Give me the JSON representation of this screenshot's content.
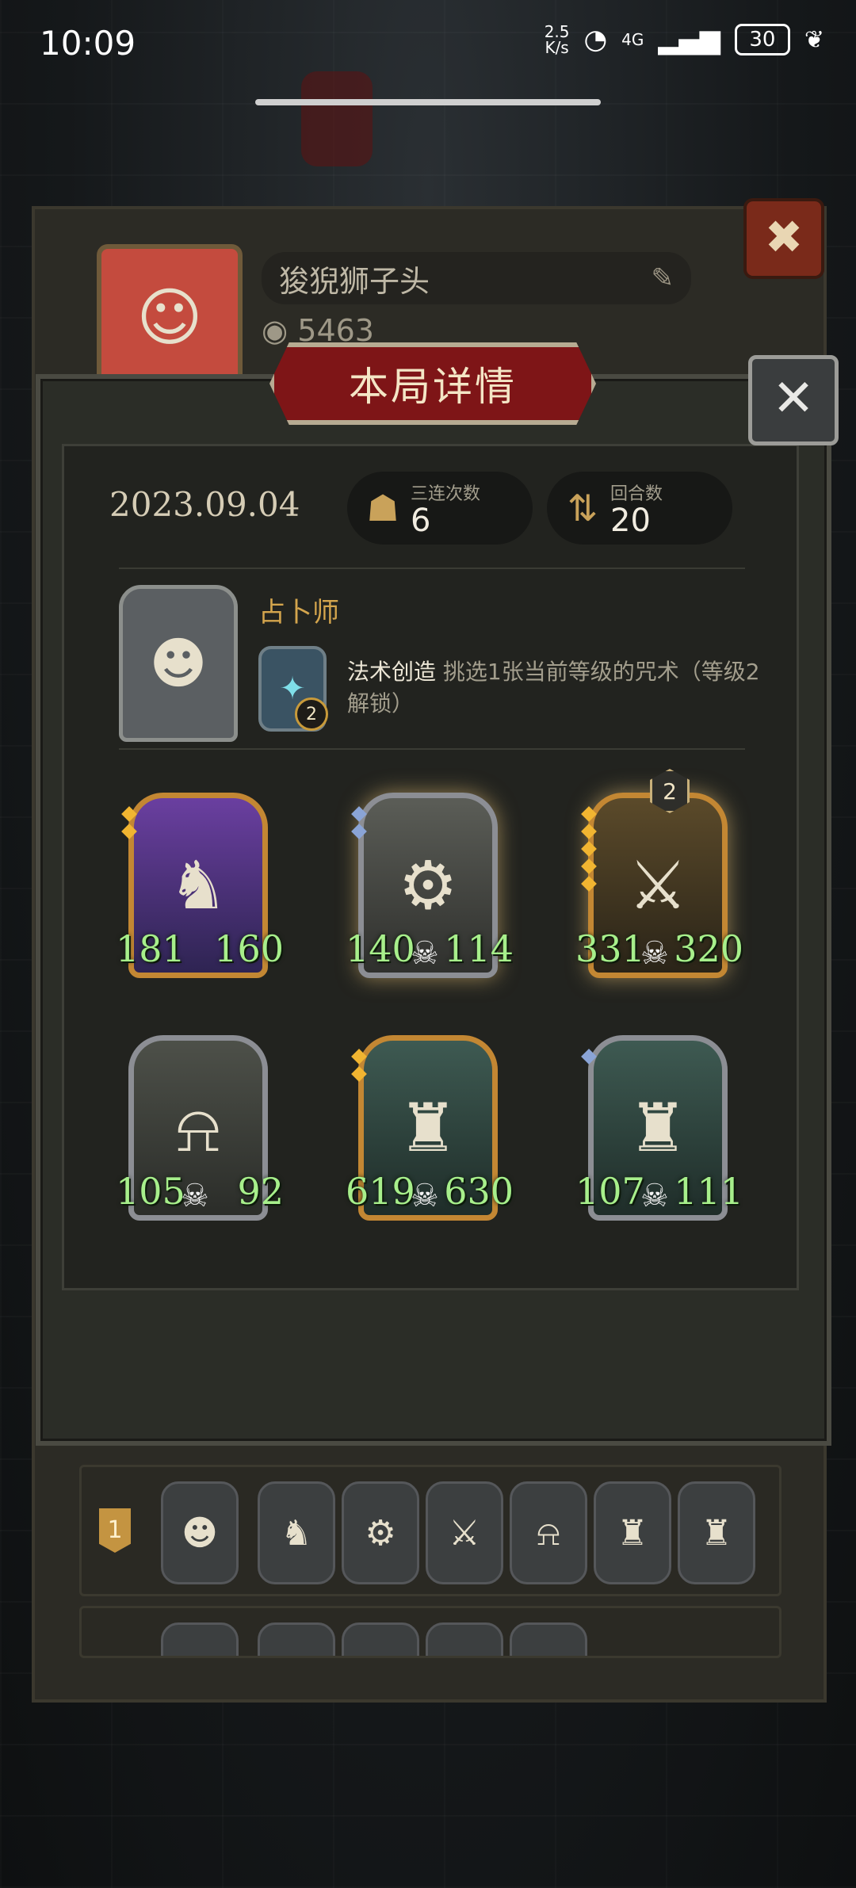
{
  "status": {
    "time": "10:09",
    "speed_top": "2.5",
    "speed_bottom": "K/s",
    "network": "4G",
    "battery": "30"
  },
  "profile": {
    "name": "狻猊狮子头",
    "coins": "5463"
  },
  "modal": {
    "title": "本局详情",
    "date": "2023.09.04",
    "stats": [
      {
        "label": "三连次数",
        "value": "6",
        "icon": "triple-icon"
      },
      {
        "label": "回合数",
        "value": "20",
        "icon": "turns-icon"
      }
    ],
    "hero": {
      "name": "占卜师",
      "ability_name": "法术创造",
      "ability_desc": "挑选1张当前等级的咒术（等级2解锁）",
      "spell_level": "2"
    },
    "units": [
      {
        "atk": "181",
        "hp": "160",
        "icon": "knight-icon"
      },
      {
        "atk": "140",
        "hp": "114",
        "icon": "robot-icon"
      },
      {
        "atk": "331",
        "hp": "320",
        "icon": "mecha-icon",
        "level": "2"
      },
      {
        "atk": "105",
        "hp": "92",
        "icon": "bell-robot-icon"
      },
      {
        "atk": "619",
        "hp": "630",
        "icon": "golem-icon"
      },
      {
        "atk": "107",
        "hp": "111",
        "icon": "golem-icon"
      }
    ]
  },
  "history": {
    "rank": "1"
  }
}
